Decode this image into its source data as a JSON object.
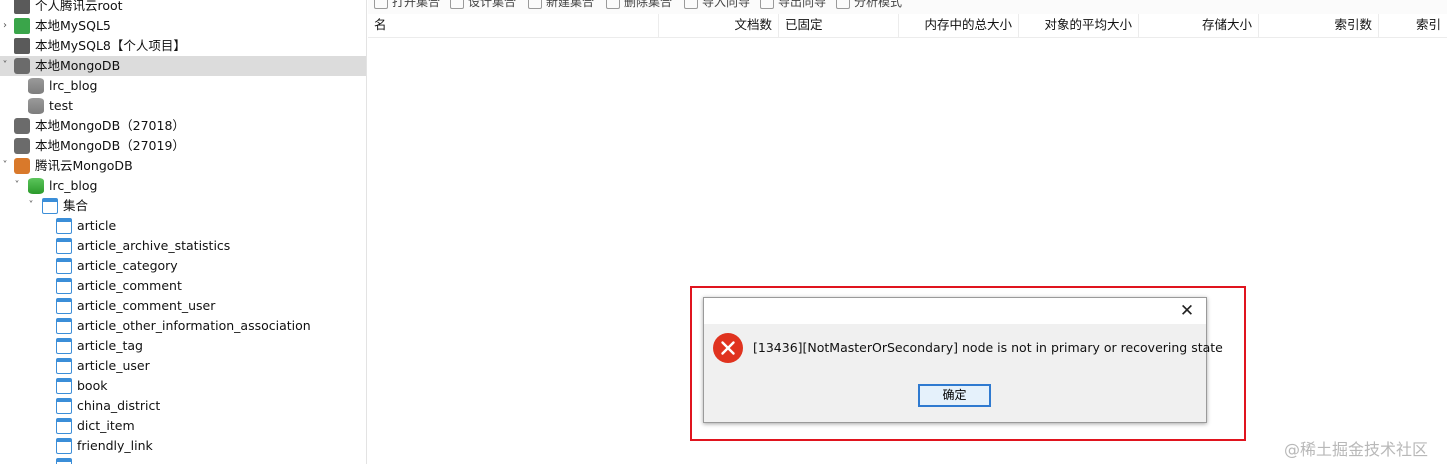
{
  "sidebar": {
    "items": [
      {
        "label": "个人腾讯云root",
        "icon": "mysql-connection-icon",
        "expanded": false
      },
      {
        "label": "本地MySQL5",
        "icon": "mysql-connection-icon",
        "expanded": false
      },
      {
        "label": "本地MySQL8【个人项目】",
        "icon": "mysql-connection-icon",
        "expanded": false
      },
      {
        "label": "本地MongoDB",
        "icon": "mongodb-connection-icon",
        "expanded": true,
        "selected": true
      },
      {
        "label": "lrc_blog",
        "icon": "database-icon"
      },
      {
        "label": "test",
        "icon": "database-icon"
      },
      {
        "label": "本地MongoDB（27018）",
        "icon": "mongodb-connection-icon"
      },
      {
        "label": "本地MongoDB（27019）",
        "icon": "mongodb-connection-icon"
      },
      {
        "label": "腾讯云MongoDB",
        "icon": "mongodb-connection-icon",
        "expanded": true
      },
      {
        "label": "lrc_blog",
        "icon": "database-icon",
        "expanded": true
      },
      {
        "label": "集合",
        "icon": "collections-folder-icon",
        "expanded": true
      },
      {
        "label": "article",
        "icon": "collection-icon"
      },
      {
        "label": "article_archive_statistics",
        "icon": "collection-icon"
      },
      {
        "label": "article_category",
        "icon": "collection-icon"
      },
      {
        "label": "article_comment",
        "icon": "collection-icon"
      },
      {
        "label": "article_comment_user",
        "icon": "collection-icon"
      },
      {
        "label": "article_other_information_association",
        "icon": "collection-icon"
      },
      {
        "label": "article_tag",
        "icon": "collection-icon"
      },
      {
        "label": "article_user",
        "icon": "collection-icon"
      },
      {
        "label": "book",
        "icon": "collection-icon"
      },
      {
        "label": "china_district",
        "icon": "collection-icon"
      },
      {
        "label": "dict_item",
        "icon": "collection-icon"
      },
      {
        "label": "friendly_link",
        "icon": "collection-icon"
      }
    ]
  },
  "toolbar": {
    "open_collection": "打开集合",
    "design_collection": "设计集合",
    "new_collection": "新建集合",
    "delete_collection": "删除集合",
    "import_wizard": "导入向导",
    "export_wizard": "导出向导",
    "analyze_mode": "分析模式"
  },
  "grid": {
    "columns": [
      "名",
      "文档数",
      "已固定",
      "内存中的总大小",
      "对象的平均大小",
      "存储大小",
      "索引数",
      "索引"
    ]
  },
  "dialog": {
    "message": "[13436][NotMasterOrSecondary] node is not in primary or recovering state",
    "ok_label": "确定",
    "close_glyph": "✕",
    "icon": "error-icon"
  },
  "watermark": {
    "text": "@稀土掘金技术社区"
  },
  "colors": {
    "highlight_border": "#e0141e",
    "error_icon": "#e0331f",
    "selected_row": "#dcdcdc",
    "collection_icon": "#3b8ed8",
    "ok_button_border": "#2f7ad0"
  }
}
